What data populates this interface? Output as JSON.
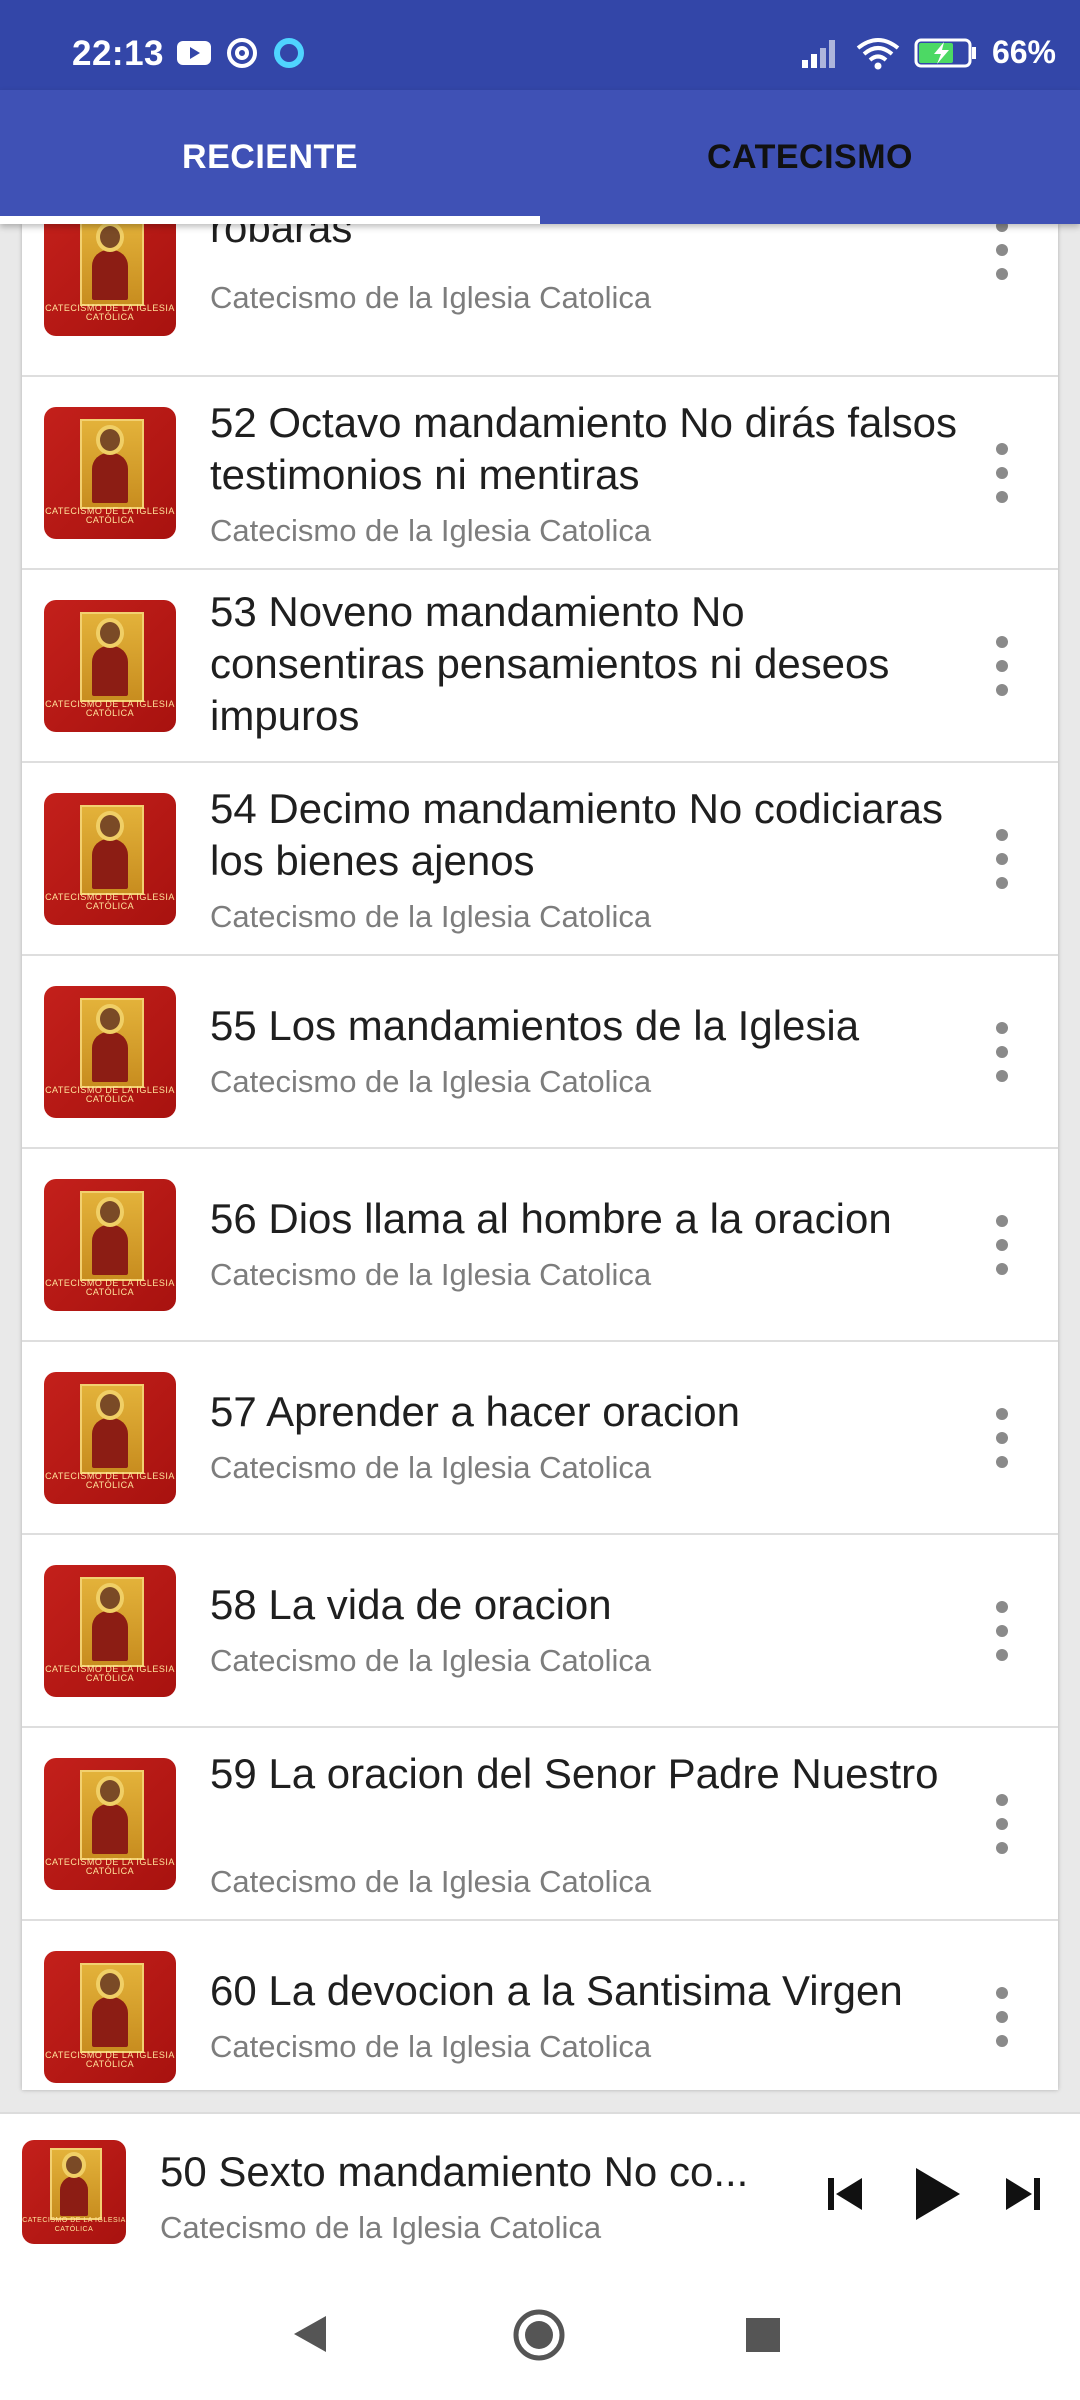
{
  "status_bar": {
    "time": "22:13",
    "battery": "66%"
  },
  "tabs": [
    {
      "label": "RECIENTE",
      "selected": true
    },
    {
      "label": "CATECISMO",
      "selected": false
    }
  ],
  "list": {
    "items": [
      {
        "title": "robaras",
        "subtitle": "Catecismo de la Iglesia Catolica"
      },
      {
        "title": "52 Octavo mandamiento No dirás falsos testimonios ni mentiras",
        "subtitle": "Catecismo de la Iglesia Catolica"
      },
      {
        "title": "53 Noveno mandamiento No consentiras pensamientos ni deseos impuros",
        "subtitle": ""
      },
      {
        "title": "54 Decimo mandamiento No codiciaras los bienes ajenos",
        "subtitle": "Catecismo de la Iglesia Catolica"
      },
      {
        "title": "55 Los mandamientos de la Iglesia",
        "subtitle": "Catecismo de la Iglesia Catolica"
      },
      {
        "title": "56 Dios llama al hombre a la oracion",
        "subtitle": "Catecismo de la Iglesia Catolica"
      },
      {
        "title": "57 Aprender a hacer oracion",
        "subtitle": "Catecismo de la Iglesia Catolica"
      },
      {
        "title": "58 La vida de oracion",
        "subtitle": "Catecismo de la Iglesia Catolica"
      },
      {
        "title": "59 La oracion del Senor Padre Nuestro",
        "subtitle": "Catecismo de la Iglesia Catolica"
      },
      {
        "title": "60 La devocion a la Santisima Virgen",
        "subtitle": "Catecismo de la Iglesia Catolica"
      }
    ],
    "thumb_caption": "CATECISMO DE LA IGLESIA CATÓLICA"
  },
  "player": {
    "title": "50 Sexto mandamiento No co...",
    "subtitle": "Catecismo de la Iglesia Catolica"
  },
  "colors": {
    "status_bar": "#3346a8",
    "tab_bar": "#3f51b5"
  },
  "icons": [
    "youtube-icon",
    "at-sign-icon",
    "circle-notification-icon",
    "signal-icon",
    "wifi-icon",
    "battery-icon",
    "more-vert-icon",
    "skip-previous-icon",
    "play-icon",
    "skip-next-icon",
    "back-icon",
    "home-icon",
    "recents-icon"
  ]
}
